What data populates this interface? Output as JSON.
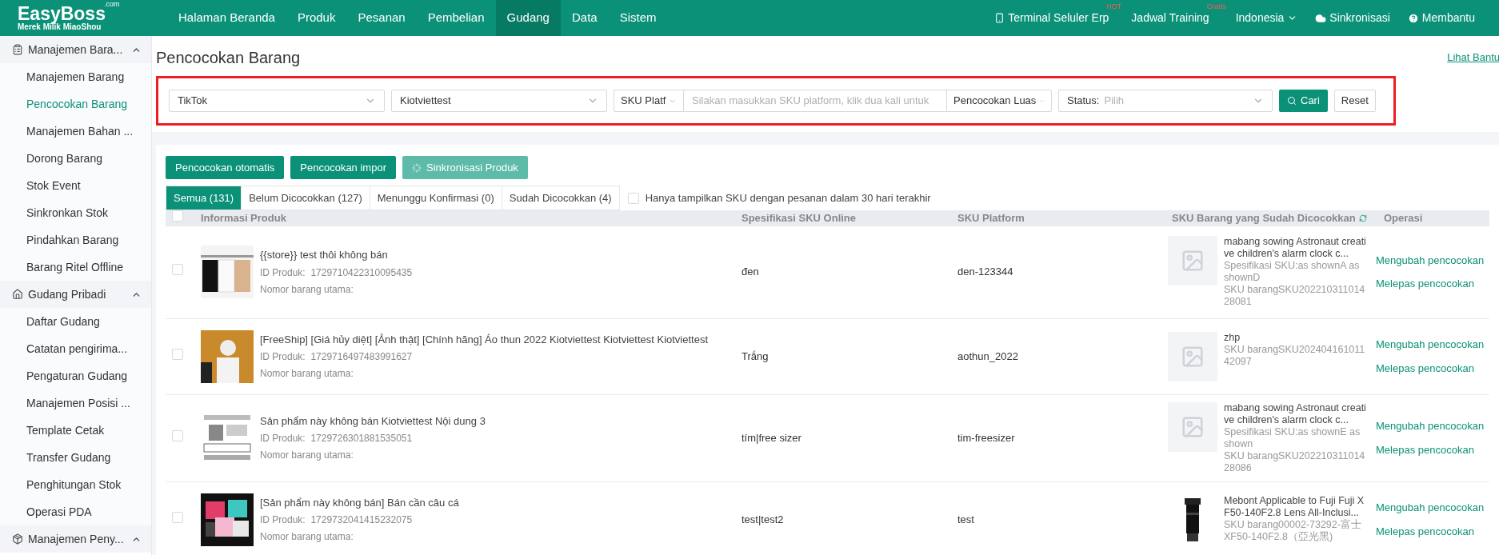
{
  "logo": {
    "name": "EasyBoss",
    "suffix": ".com",
    "tagline": "Merek Milik MiaoShou"
  },
  "nav": [
    {
      "label": "Halaman Beranda",
      "selected": false
    },
    {
      "label": "Produk",
      "selected": false
    },
    {
      "label": "Pesanan",
      "selected": false
    },
    {
      "label": "Pembelian",
      "selected": false
    },
    {
      "label": "Gudang",
      "selected": true
    },
    {
      "label": "Data",
      "selected": false
    },
    {
      "label": "Sistem",
      "selected": false
    }
  ],
  "top_right": [
    {
      "kind": "phone",
      "label": "Terminal Seluler Erp",
      "badge": "HOT"
    },
    {
      "kind": "plain",
      "label": "Jadwal Training",
      "badge": "Gratis"
    },
    {
      "kind": "dropdown",
      "label": "Indonesia"
    },
    {
      "kind": "cloud",
      "label": "Sinkronisasi"
    },
    {
      "kind": "help",
      "label": "Membantu"
    }
  ],
  "sidebar": [
    {
      "label": "Manajemen Bara...",
      "expanded": true,
      "children": [
        {
          "label": "Manajemen Barang",
          "selected": false
        },
        {
          "label": "Pencocokan Barang",
          "selected": true
        },
        {
          "label": "Manajemen Bahan ...",
          "selected": false
        },
        {
          "label": "Dorong Barang",
          "selected": false
        },
        {
          "label": "Stok Event",
          "selected": false
        },
        {
          "label": "Sinkronkan Stok",
          "selected": false
        },
        {
          "label": "Pindahkan Barang",
          "selected": false
        },
        {
          "label": "Barang Ritel Offline",
          "selected": false
        }
      ]
    },
    {
      "label": "Gudang Pribadi",
      "expanded": true,
      "children": [
        {
          "label": "Daftar Gudang",
          "selected": false
        },
        {
          "label": "Catatan pengirima...",
          "selected": false
        },
        {
          "label": "Pengaturan Gudang",
          "selected": false
        },
        {
          "label": "Manajemen Posisi ...",
          "selected": false
        },
        {
          "label": "Template Cetak",
          "selected": false
        },
        {
          "label": "Transfer Gudang",
          "selected": false
        },
        {
          "label": "Penghitungan Stok",
          "selected": false
        },
        {
          "label": "Operasi PDA",
          "selected": false
        }
      ]
    },
    {
      "label": "Manajemen Peny...",
      "expanded": true
    }
  ],
  "page_title": "Pencocokan Barang",
  "help_link": "Lihat Bantu",
  "filters": {
    "highlighted": true,
    "platform": "TikTok",
    "store": "Kiotviettest",
    "sku_type": "SKU Platf",
    "sku_placeholder": "Silakan masukkan SKU platform, klik dua kali untuk",
    "match_mode": "Pencocokan Luas",
    "status_label": "Status:",
    "status_placeholder": "Pilih",
    "search": "Cari",
    "reset": "Reset"
  },
  "actions": [
    {
      "label": "Pencocokan otomatis",
      "disabled": false,
      "loading": false
    },
    {
      "label": "Pencocokan impor",
      "disabled": false,
      "loading": false
    },
    {
      "label": "Sinkronisasi Produk",
      "disabled": true,
      "loading": true
    }
  ],
  "tabs": [
    {
      "label": "Semua (131)",
      "selected": true
    },
    {
      "label": "Belum Dicocokkan (127)",
      "selected": false
    },
    {
      "label": "Menunggu Konfirmasi (0)",
      "selected": false
    },
    {
      "label": "Sudah Dicocokkan (4)",
      "selected": false
    }
  ],
  "recent_filter": {
    "label": "Hanya tampilkan SKU dengan pesanan dalam 30 hari terakhir",
    "checked": false
  },
  "table": {
    "all_checked": false,
    "columns": [
      "Informasi Produk",
      "Spesifikasi SKU Online",
      "SKU Platform",
      "SKU Barang yang Sudah Dicocokkan",
      "Operasi"
    ],
    "rows": [
      {
        "checked": false,
        "title": "{{store}} test thôi không bán",
        "id_label": "ID Produk:",
        "id": "1729710422310095435",
        "main_no_label": "Nomor barang utama:",
        "spec": "đen",
        "platform_sku": "den-123344",
        "matched": {
          "kind": "placeholder",
          "name": "mabang sowing Astronaut creative children's alarm clock c...",
          "spec": "Spesifikasi SKU:as shownA as shownD",
          "sku": "SKU barangSKU20221031101428081"
        },
        "ops": [
          "Mengubah pencocokan",
          "Melepas pencocokan"
        ]
      },
      {
        "checked": false,
        "title": "[FreeShip] [Giá hủy diệt] [Ảnh thật] [Chính hãng] Áo thun 2022 Kiotviettest Kiotviettest Kiotviettest",
        "id_label": "ID Produk:",
        "id": "1729716497483991627",
        "main_no_label": "Nomor barang utama:",
        "spec": "Trắng",
        "platform_sku": "aothun_2022",
        "matched": {
          "kind": "placeholder",
          "name": "zhp",
          "sku": "SKU barangSKU20240416101142097"
        },
        "ops": [
          "Mengubah pencocokan",
          "Melepas pencocokan"
        ]
      },
      {
        "checked": false,
        "title": "Sản phẩm này không bán  Kiotviettest Nội dung 3",
        "id_label": "ID Produk:",
        "id": "1729726301881535051",
        "main_no_label": "Nomor barang utama:",
        "spec": "tím|free sizer",
        "platform_sku": "tim-freesizer",
        "matched": {
          "kind": "placeholder",
          "name": "mabang sowing Astronaut creative children's alarm clock c...",
          "spec": "Spesifikasi SKU:as shownE as shown",
          "sku": "SKU barangSKU20221031101428086"
        },
        "ops": [
          "Mengubah pencocokan",
          "Melepas pencocokan"
        ]
      },
      {
        "checked": false,
        "title": "[Sản phẩm này không bán] Bán cần câu cá",
        "id_label": "ID Produk:",
        "id": "1729732041415232075",
        "main_no_label": "Nomor barang utama:",
        "spec": "test|test2",
        "platform_sku": "test",
        "matched": {
          "kind": "picture",
          "name": "Mebont Applicable to Fuji Fuji XF50-140F2.8 Lens All-Inclusi...",
          "sku": "SKU barang00002-73292-富士XF50-140F2.8（亞光黑)"
        },
        "ops": [
          "Mengubah pencocokan",
          "Melepas pencocokan"
        ]
      }
    ]
  }
}
